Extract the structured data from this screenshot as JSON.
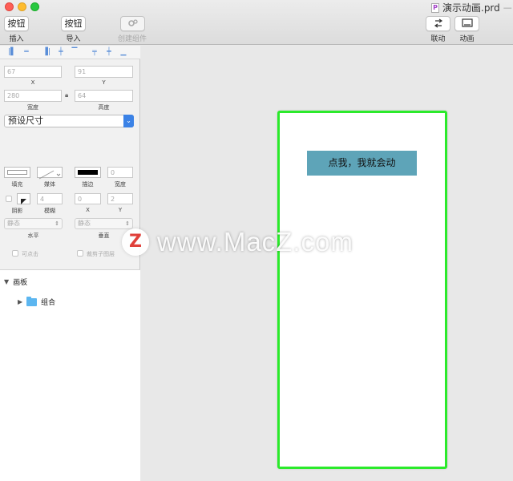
{
  "window": {
    "title": "演示动画.prd",
    "title_tail": "— E",
    "doc_icon_letter": "P"
  },
  "toolbar": {
    "insert_button": "按钮",
    "insert_label": "插入",
    "import_button": "按钮",
    "import_label": "导入",
    "create_component_label": "创建组件",
    "link_label": "联动",
    "animation_label": "动画"
  },
  "geometry": {
    "x_value": "67",
    "x_label": "X",
    "y_value": "91",
    "y_label": "Y",
    "width_value": "280",
    "width_label": "宽度",
    "height_value": "64",
    "height_label": "高度",
    "preset_size": "预设尺寸"
  },
  "style": {
    "fill_label": "填充",
    "media_label": "媒体",
    "stroke_label": "描边",
    "stroke_width_value": "0",
    "stroke_width_label": "宽度",
    "shadow_label": "阴影",
    "blur_value": "4",
    "blur_label": "模糊",
    "shadow_x_value": "0",
    "shadow_x_label": "X",
    "shadow_y_value": "2",
    "shadow_y_label": "Y",
    "horizontal_value": "静态",
    "horizontal_label": "水平",
    "vertical_value": "静态",
    "vertical_label": "垂直",
    "clickable_label": "可点击",
    "clip_children_label": "裁剪子图层"
  },
  "layers": {
    "root_label": "画板",
    "child_label": "组合"
  },
  "canvas": {
    "demo_button_text": "点我，我就会动",
    "artboard_border_color": "#2bea2b",
    "demo_button_color": "#5ea4b8"
  },
  "watermark": {
    "logo_letter": "Z",
    "text": "www.MacZ.com"
  }
}
